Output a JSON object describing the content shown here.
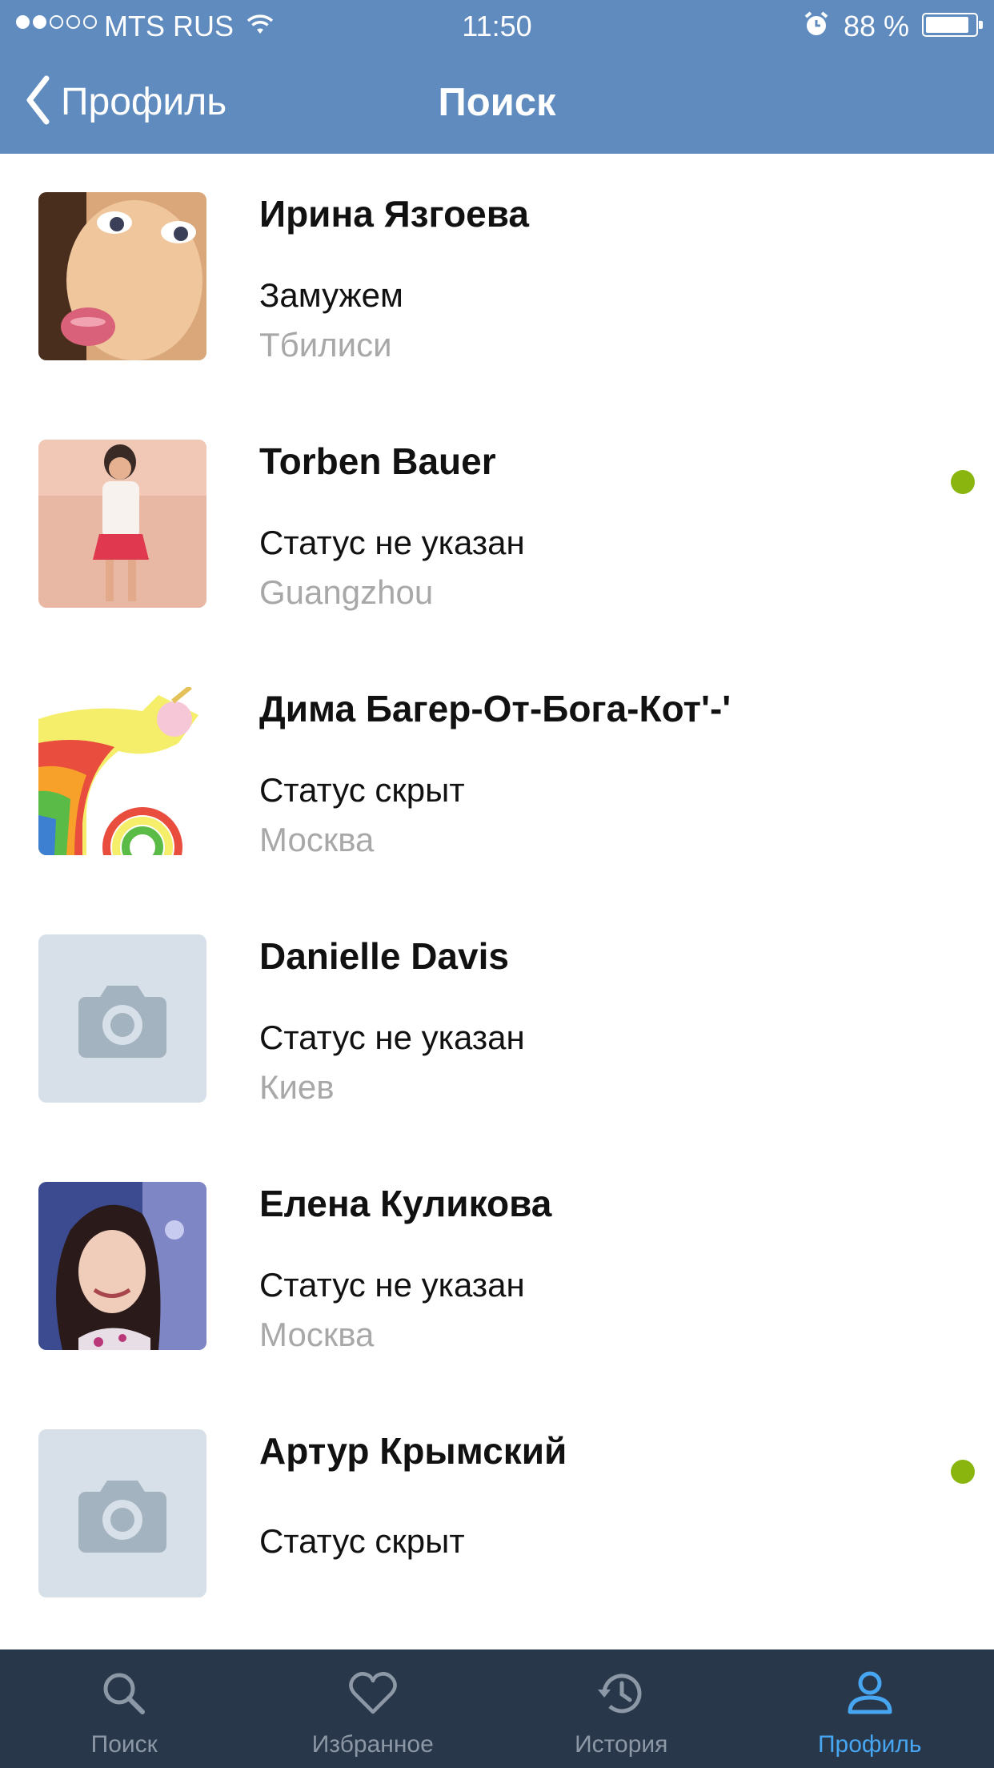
{
  "status_bar": {
    "carrier": "MTS RUS",
    "time": "11:50",
    "battery": "88 %",
    "signal_bars": 2
  },
  "nav": {
    "back_label": "Профиль",
    "title": "Поиск"
  },
  "colors": {
    "nav_bar": "#5f8bbf",
    "tab_bar": "#29374a",
    "active_tab": "#47a6f2",
    "online": "#8ab50e"
  },
  "people": [
    {
      "name": "Ирина Язгоева",
      "status": "Замужем",
      "city": "Тбилиси",
      "online": false,
      "photo": "photo"
    },
    {
      "name": "Torben Bauer",
      "status": "Статус не указан",
      "city": "Guangzhou",
      "online": true,
      "photo": "photo"
    },
    {
      "name": "Дима Багер-От-Бога-Кот'-'",
      "status": "Статус скрыт",
      "city": "Москва",
      "online": false,
      "photo": "photo"
    },
    {
      "name": "Danielle Davis",
      "status": "Статус не указан",
      "city": "Киев",
      "online": false,
      "photo": "camera-placeholder"
    },
    {
      "name": "Елена Куликова",
      "status": "Статус не указан",
      "city": "Москва",
      "online": false,
      "photo": "photo"
    },
    {
      "name": "Артур Крымский",
      "status": "Статус скрыт",
      "city": "",
      "online": true,
      "photo": "camera-placeholder"
    }
  ],
  "tabs": [
    {
      "label": "Поиск",
      "icon": "search-icon",
      "active": false
    },
    {
      "label": "Избранное",
      "icon": "heart-icon",
      "active": false
    },
    {
      "label": "История",
      "icon": "history-icon",
      "active": false
    },
    {
      "label": "Профиль",
      "icon": "person-icon",
      "active": true
    }
  ]
}
